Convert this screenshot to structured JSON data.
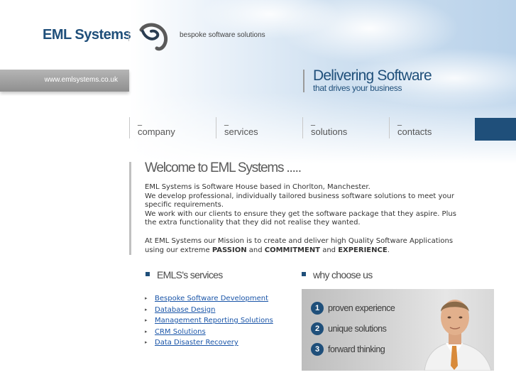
{
  "header": {
    "logo_text": "EML Systems",
    "tagline": "bespoke software solutions",
    "url": "www.emlsystems.co.uk",
    "headline_main": "Delivering Software",
    "headline_sub": "that drives your business"
  },
  "nav": {
    "dash": "_",
    "items": [
      {
        "label": "company"
      },
      {
        "label": "services"
      },
      {
        "label": "solutions"
      },
      {
        "label": "contacts"
      }
    ]
  },
  "welcome": {
    "title": "Welcome to EML Systems .....",
    "para1": [
      "EML Systems is Software House based in Chorlton, Manchester.",
      "We develop professional, individually tailored business software solutions to meet your specific requirements.",
      "We work with our clients to ensure they get the software package that they aspire. Plus the extra functionality that they did not realise they wanted."
    ],
    "para2": {
      "prefix": "At EML Systems our Mission is to create and deliver high Quality Software Applications using our extreme ",
      "word1": "PASSION",
      "and1": " and ",
      "word2": "COMMITMENT",
      "and2": " and ",
      "word3": "EXPERIENCE",
      "suffix": "."
    }
  },
  "services": {
    "heading": "EMLS's services",
    "bullet": "▸",
    "items": [
      {
        "label": "Bespoke Software Development"
      },
      {
        "label": "Database Design"
      },
      {
        "label": "Management Reporting Solutions"
      },
      {
        "label": "CRM Solutions"
      },
      {
        "label": "Data Disaster Recovery"
      }
    ]
  },
  "why": {
    "heading": "why choose us",
    "items": [
      {
        "num": "1",
        "label": "proven experience"
      },
      {
        "num": "2",
        "label": "unique solutions"
      },
      {
        "num": "3",
        "label": "forward thinking"
      }
    ]
  },
  "colors": {
    "brand_blue": "#1f4f7a",
    "link_blue": "#1a55a8"
  }
}
